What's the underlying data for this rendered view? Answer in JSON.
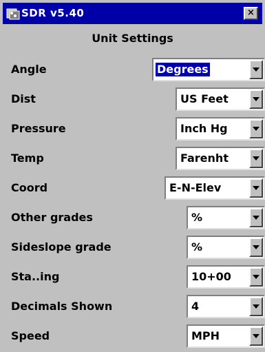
{
  "window": {
    "title": "SDR v5.40",
    "close_label": "×"
  },
  "heading": "Unit Settings",
  "settings": [
    {
      "label": "Angle",
      "value": "Degrees",
      "focused": true
    },
    {
      "label": "Dist",
      "value": "US Feet"
    },
    {
      "label": "Pressure",
      "value": "Inch Hg"
    },
    {
      "label": "Temp",
      "value": "Farenht"
    },
    {
      "label": "Coord",
      "value": "E-N-Elev"
    },
    {
      "label": "Other grades",
      "value": "%"
    },
    {
      "label": "Sideslope grade",
      "value": "%"
    },
    {
      "label": "Sta..ing",
      "value": "10+00"
    },
    {
      "label": "Decimals Shown",
      "value": "4"
    },
    {
      "label": "Speed",
      "value": "MPH"
    }
  ],
  "colors": {
    "titlebar": "#0000a8",
    "window_bg": "#c0c0c0",
    "focus": "#0000a8"
  },
  "icons": {
    "app": "app-icon",
    "close": "close-icon",
    "dropdown": "dropdown-arrow-icon"
  }
}
